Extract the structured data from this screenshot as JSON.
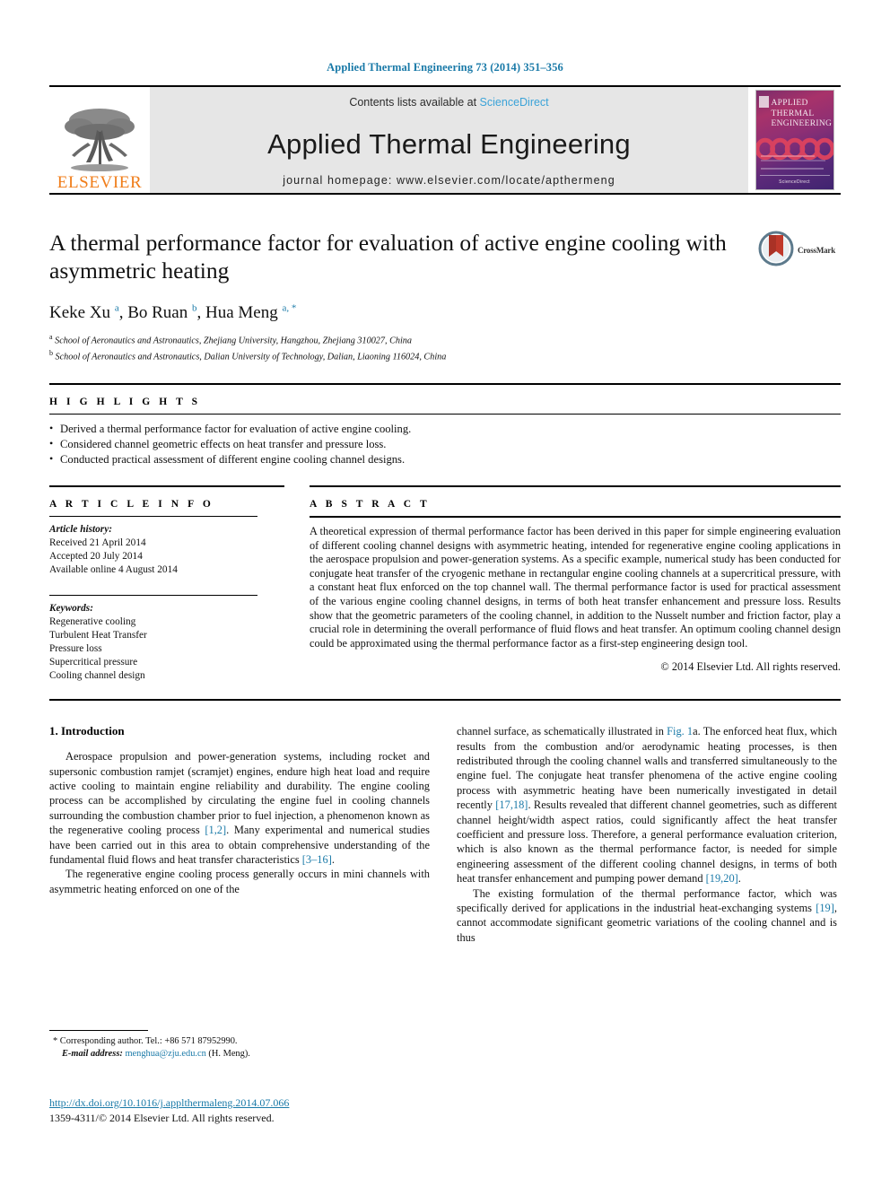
{
  "running_head": "Applied Thermal Engineering 73 (2014) 351–356",
  "masthead": {
    "publisher": "ELSEVIER",
    "contents_prefix": "Contents lists available at ",
    "sciencedirect": "ScienceDirect",
    "journal_title": "Applied Thermal Engineering",
    "homepage": "journal homepage: www.elsevier.com/locate/apthermeng",
    "cover_title_line1": "APPLIED",
    "cover_title_line2": "THERMAL",
    "cover_title_line3": "ENGINEERING"
  },
  "article": {
    "title": "A thermal performance factor for evaluation of active engine cooling with asymmetric heating",
    "crossmark_label": "CrossMark",
    "authors_html": "Keke Xu <sup>a</sup>, Bo Ruan <sup>b</sup>, Hua Meng <sup>a, *</sup>",
    "affiliation_a": "School of Aeronautics and Astronautics, Zhejiang University, Hangzhou, Zhejiang 310027, China",
    "affiliation_b": "School of Aeronautics and Astronautics, Dalian University of Technology, Dalian, Liaoning 116024, China"
  },
  "highlights": {
    "heading": "H I G H L I G H T S",
    "items": [
      "Derived a thermal performance factor for evaluation of active engine cooling.",
      "Considered channel geometric effects on heat transfer and pressure loss.",
      "Conducted practical assessment of different engine cooling channel designs."
    ]
  },
  "article_info": {
    "heading": "A R T I C L E   I N F O",
    "history_label": "Article history:",
    "received": "Received 21 April 2014",
    "accepted": "Accepted 20 July 2014",
    "available": "Available online 4 August 2014",
    "keywords_label": "Keywords:",
    "keywords": [
      "Regenerative cooling",
      "Turbulent Heat Transfer",
      "Pressure loss",
      "Supercritical pressure",
      "Cooling channel design"
    ]
  },
  "abstract": {
    "heading": "A B S T R A C T",
    "text": "A theoretical expression of thermal performance factor has been derived in this paper for simple engineering evaluation of different cooling channel designs with asymmetric heating, intended for regenerative engine cooling applications in the aerospace propulsion and power-generation systems. As a specific example, numerical study has been conducted for conjugate heat transfer of the cryogenic methane in rectangular engine cooling channels at a supercritical pressure, with a constant heat flux enforced on the top channel wall. The thermal performance factor is used for practical assessment of the various engine cooling channel designs, in terms of both heat transfer enhancement and pressure loss. Results show that the geometric parameters of the cooling channel, in addition to the Nusselt number and friction factor, play a crucial role in determining the overall performance of fluid flows and heat transfer. An optimum cooling channel design could be approximated using the thermal performance factor as a first-step engineering design tool.",
    "copyright": "© 2014 Elsevier Ltd. All rights reserved."
  },
  "introduction": {
    "heading": "1. Introduction",
    "para1_a": "Aerospace propulsion and power-generation systems, including rocket and supersonic combustion ramjet (scramjet) engines, endure high heat load and require active cooling to maintain engine reliability and durability. The engine cooling process can be accomplished by circulating the engine fuel in cooling channels surrounding the combustion chamber prior to fuel injection, a phenomenon known as the regenerative cooling process ",
    "para1_ref1": "[1,2]",
    "para1_b": ". Many experimental and numerical studies have been carried out in this area to obtain comprehensive understanding of the fundamental fluid flows and heat transfer characteristics ",
    "para1_ref2": "[3–16]",
    "para1_c": ".",
    "para2": "The regenerative engine cooling process generally occurs in mini channels with asymmetric heating enforced on one of the",
    "para3_a": "channel surface, as schematically illustrated in ",
    "para3_ref1": "Fig. 1",
    "para3_b": "a. The enforced heat flux, which results from the combustion and/or aerodynamic heating processes, is then redistributed through the cooling channel walls and transferred simultaneously to the engine fuel. The conjugate heat transfer phenomena of the active engine cooling process with asymmetric heating have been numerically investigated in detail recently ",
    "para3_ref2": "[17,18]",
    "para3_c": ". Results revealed that different channel geometries, such as different channel height/width aspect ratios, could significantly affect the heat transfer coefficient and pressure loss. Therefore, a general performance evaluation criterion, which is also known as the thermal performance factor, is needed for simple engineering assessment of the different cooling channel designs, in terms of both heat transfer enhancement and pumping power demand ",
    "para3_ref3": "[19,20]",
    "para3_d": ".",
    "para4_a": "The existing formulation of the thermal performance factor, which was specifically derived for applications in the industrial heat-exchanging systems ",
    "para4_ref1": "[19]",
    "para4_b": ", cannot accommodate significant geometric variations of the cooling channel and is thus"
  },
  "footnote": {
    "corresponding": "* Corresponding author. Tel.: +86 571 87952990.",
    "email_label": "E-mail address:",
    "email": "menghua@zju.edu.cn",
    "email_suffix": "(H. Meng).",
    "doi": "http://dx.doi.org/10.1016/j.applthermaleng.2014.07.066",
    "issn": "1359-4311/© 2014 Elsevier Ltd. All rights reserved."
  },
  "colors": {
    "link_blue": "#1a7aa8",
    "sciencedirect_blue": "#3aa3d8",
    "elsevier_orange": "#f07d1a",
    "band_grey": "#e6e6e6"
  }
}
